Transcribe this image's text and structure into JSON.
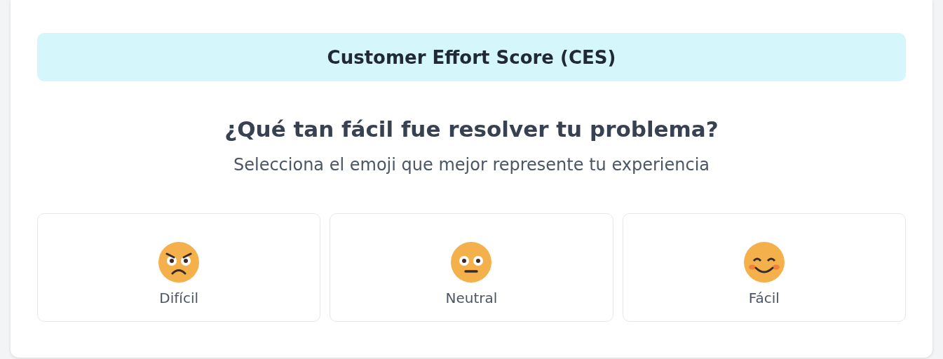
{
  "banner": {
    "title": "Customer Effort Score (CES)"
  },
  "question": "¿Qué tan fácil fue resolver tu problema?",
  "instruction": "Selecciona el emoji que mejor represente tu experiencia",
  "options": [
    {
      "kind": "angry",
      "label": "Difícil"
    },
    {
      "kind": "neutral",
      "label": "Neutral"
    },
    {
      "kind": "happy",
      "label": "Fácil"
    }
  ]
}
